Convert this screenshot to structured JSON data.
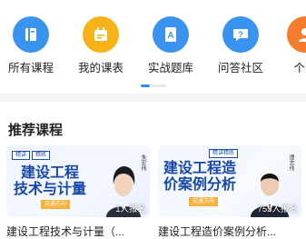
{
  "nav": {
    "items": [
      {
        "label": "所有课程",
        "icon": "book-icon",
        "color": "#3b93f0"
      },
      {
        "label": "我的课表",
        "icon": "schedule-icon",
        "color": "#f5b317"
      },
      {
        "label": "实战题库",
        "icon": "question-bank-icon",
        "color": "#3b93f0"
      },
      {
        "label": "问答社区",
        "icon": "qa-bubble-icon",
        "color": "#3b93f0"
      },
      {
        "label": "个人",
        "icon": "person-icon",
        "color": "#f47c2c"
      }
    ]
  },
  "section": {
    "title": "推荐课程"
  },
  "courses": [
    {
      "poster_tags": [
        "精讲",
        "精练"
      ],
      "poster_title_line1": "建设工程",
      "poster_title_line2": "技术与计量",
      "poster_ribbon": "交通方向",
      "teacher": "朱宏伟",
      "count_text": "1人报名",
      "title": "建设工程技术与计量（..."
    },
    {
      "poster_tags": [
        "精讲精练"
      ],
      "poster_title_line1": "建设工程造",
      "poster_title_line2": "价案例分析",
      "poster_ribbon": "交通方向",
      "teacher": "谭志伟",
      "count_text": "753人报名",
      "title": "建设工程造价案例分析..."
    }
  ]
}
